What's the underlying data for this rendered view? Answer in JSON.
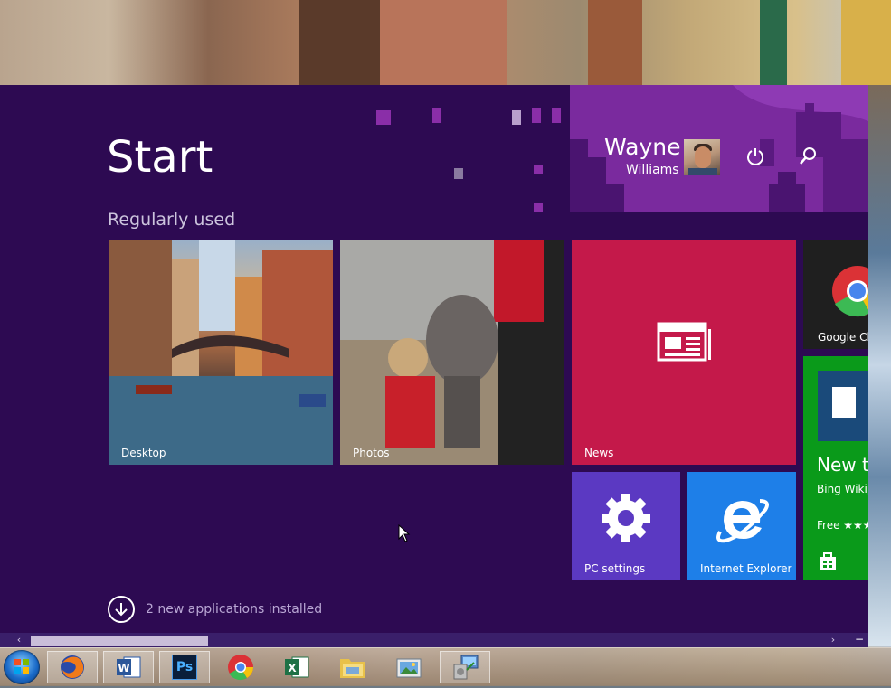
{
  "start": {
    "title": "Start",
    "section_label": "Regularly used",
    "user": {
      "first_name": "Wayne",
      "last_name": "Williams"
    },
    "buttons": {
      "power": "power-icon",
      "search": "search-icon"
    },
    "tiles": {
      "desktop": {
        "label": "Desktop"
      },
      "photos": {
        "label": "Photos"
      },
      "news": {
        "label": "News",
        "icon": "newspaper-icon",
        "color": "#c4194a"
      },
      "chrome": {
        "label": "Google Ch",
        "icon": "chrome-icon"
      },
      "store": {
        "headline": "New te",
        "subtitle": "Bing Wikip",
        "price": "Free ★★★",
        "icon": "store-icon",
        "color": "#0a9a1a"
      },
      "pc_settings": {
        "label": "PC settings",
        "icon": "gear-icon",
        "color": "#5b39c2"
      },
      "ie": {
        "label": "Internet Explorer",
        "icon": "ie-icon",
        "color": "#1e7fe8"
      }
    },
    "apps_installed": "2 new applications installed",
    "scrollbar": {
      "left": "‹",
      "right": "›",
      "minimize": "−"
    }
  },
  "taskbar": {
    "items": [
      {
        "name": "firefox",
        "icon": "firefox-icon"
      },
      {
        "name": "word",
        "icon": "word-icon"
      },
      {
        "name": "photoshop",
        "icon": "photoshop-icon",
        "text": "Ps"
      },
      {
        "name": "chrome",
        "icon": "chrome-icon"
      },
      {
        "name": "excel",
        "icon": "excel-icon"
      },
      {
        "name": "file-explorer",
        "icon": "folder-icon"
      },
      {
        "name": "photo-viewer",
        "icon": "photo-viewer-icon"
      },
      {
        "name": "setup",
        "icon": "installer-icon"
      }
    ]
  },
  "colors": {
    "start_bg": "#2d0a52",
    "accent": "#7a2a9e"
  }
}
